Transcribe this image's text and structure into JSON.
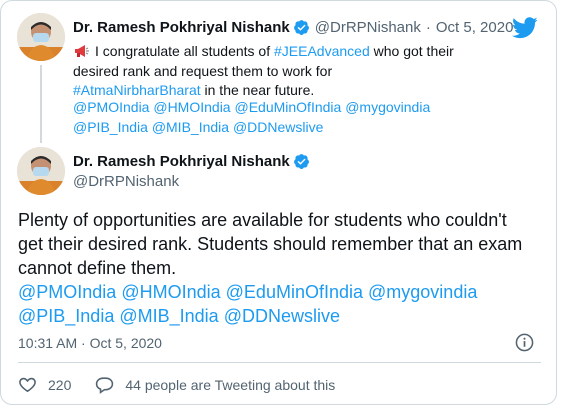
{
  "colors": {
    "link": "#1d9bf0",
    "verified": "#1d9bf0",
    "text": "#0f1419",
    "muted": "#536471",
    "border": "#cfd9de"
  },
  "quoted_tweet": {
    "author_name": "Dr. Ramesh Pokhriyal Nishank",
    "handle": "@DrRPNishank",
    "separator": "·",
    "date": "Oct 5, 2020",
    "text_intro": "I congratulate all students of ",
    "hashtag_1": "#JEEAdvanced",
    "text_middle": " who got their desired rank and request them to work for ",
    "hashtag_2": "#AtmaNirbharBharat",
    "text_end": " in the near future.",
    "mentions": [
      "@PMOIndia",
      "@HMOIndia",
      "@EduMinOfIndia",
      "@mygovindia",
      "@PIB_India",
      "@MIB_India",
      "@DDNewslive"
    ]
  },
  "main_tweet": {
    "author_name": "Dr. Ramesh Pokhriyal Nishank",
    "handle": "@DrRPNishank",
    "text": "Plenty of opportunities are available for students who couldn't get their desired rank. Students should remember that an exam cannot define them.",
    "mentions": [
      "@PMOIndia",
      "@HMOIndia",
      "@EduMinOfIndia",
      "@mygovindia",
      "@PIB_India",
      "@MIB_India",
      "@DDNewslive"
    ],
    "timestamp": "10:31 AM · Oct 5, 2020"
  },
  "actions": {
    "like_count": "220",
    "reply_text": "44 people are Tweeting about this"
  },
  "icons": {
    "brand": "twitter-bird-icon",
    "verified": "verified-badge-icon",
    "emoji": "megaphone-icon",
    "info": "info-icon",
    "like": "heart-icon",
    "reply": "speech-bubble-icon"
  }
}
